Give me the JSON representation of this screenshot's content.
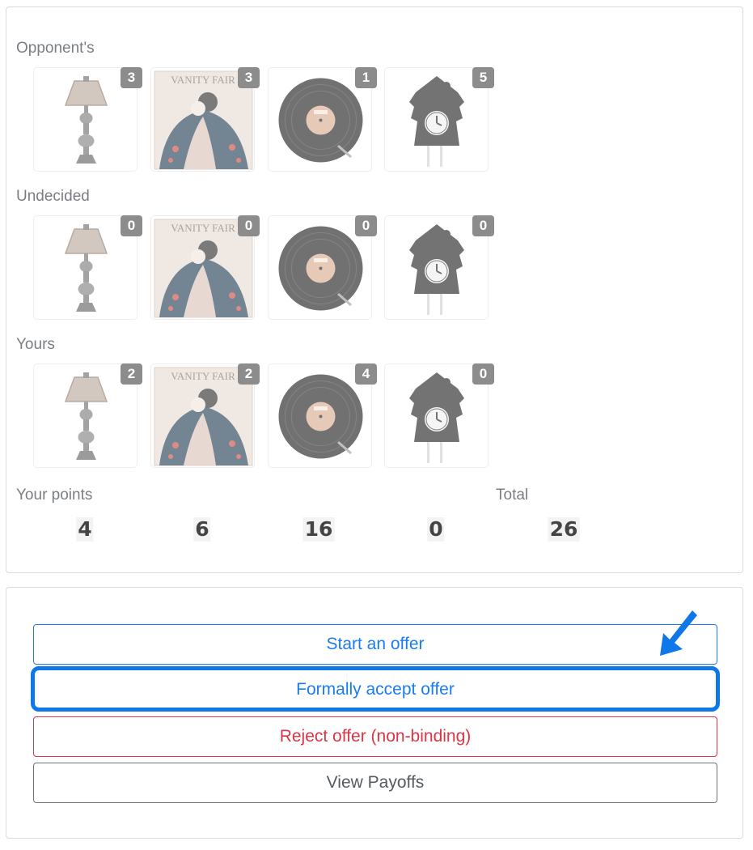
{
  "items": {
    "icon_names": [
      "lamp-icon",
      "painting-icon",
      "vinyl-record-icon",
      "cuckoo-clock-icon"
    ],
    "sections": [
      {
        "label": "Opponent's",
        "counts": [
          3,
          3,
          1,
          5
        ]
      },
      {
        "label": "Undecided",
        "counts": [
          0,
          0,
          0,
          0
        ]
      },
      {
        "label": "Yours",
        "counts": [
          2,
          2,
          4,
          0
        ]
      }
    ],
    "painting_caption": "VANITY FAIR"
  },
  "points": {
    "label": "Your points",
    "total_label": "Total",
    "values": [
      4,
      6,
      16,
      0
    ],
    "total": 26
  },
  "actions": {
    "start_label": "Start an offer",
    "accept_label": "Formally accept offer",
    "reject_label": "Reject offer (non-binding)",
    "payoffs_label": "View Payoffs"
  },
  "colors": {
    "primary": "#1a7cf2",
    "danger": "#dc3545",
    "secondary": "#6c757d",
    "badge": "#8c8c8c",
    "highlight": "#0f78e8"
  }
}
